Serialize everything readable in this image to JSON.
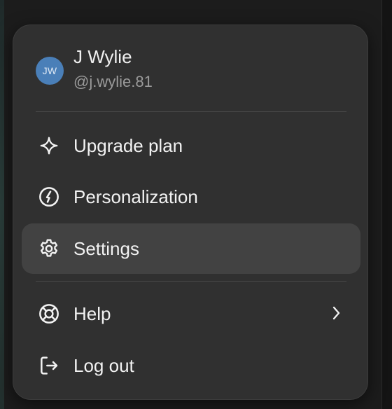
{
  "user": {
    "initials": "JW",
    "name": "J Wylie",
    "handle": "@j.wylie.81"
  },
  "menu": {
    "items": [
      {
        "label": "Upgrade plan",
        "icon": "sparkle-icon"
      },
      {
        "label": "Personalization",
        "icon": "personalization-icon"
      },
      {
        "label": "Settings",
        "icon": "gear-icon"
      },
      {
        "label": "Help",
        "icon": "lifebuoy-icon"
      },
      {
        "label": "Log out",
        "icon": "logout-icon"
      }
    ],
    "active_item": "Settings"
  },
  "colors": {
    "menu_bg": "#303030",
    "hover_bg": "#424242",
    "avatar_bg": "#4a7fb8",
    "text_primary": "#f2f2f2",
    "text_secondary": "#9a9a9a"
  }
}
